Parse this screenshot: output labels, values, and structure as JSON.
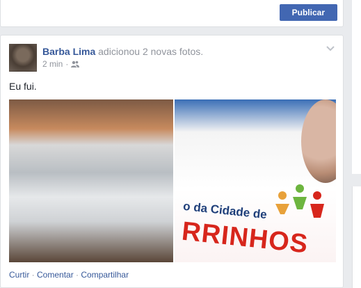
{
  "composer": {
    "publish_label": "Publicar"
  },
  "post": {
    "author": "Barba Lima",
    "action_text": " adicionou 2 novas fotos.",
    "timestamp": "2 min",
    "separator": "·",
    "audience_icon": "friends-icon",
    "text": "Eu fui.",
    "photos": [
      {
        "name": "photo-1"
      },
      {
        "name": "photo-2",
        "overlay_small": "o da Cidade de",
        "overlay_large": "RRINHOS"
      }
    ],
    "actions": {
      "like": "Curtir",
      "comment": "Comentar",
      "share": "Compartilhar",
      "sep": " · "
    }
  },
  "colors": {
    "link": "#365899",
    "primary_button": "#4267b2",
    "muted": "#90949c"
  }
}
